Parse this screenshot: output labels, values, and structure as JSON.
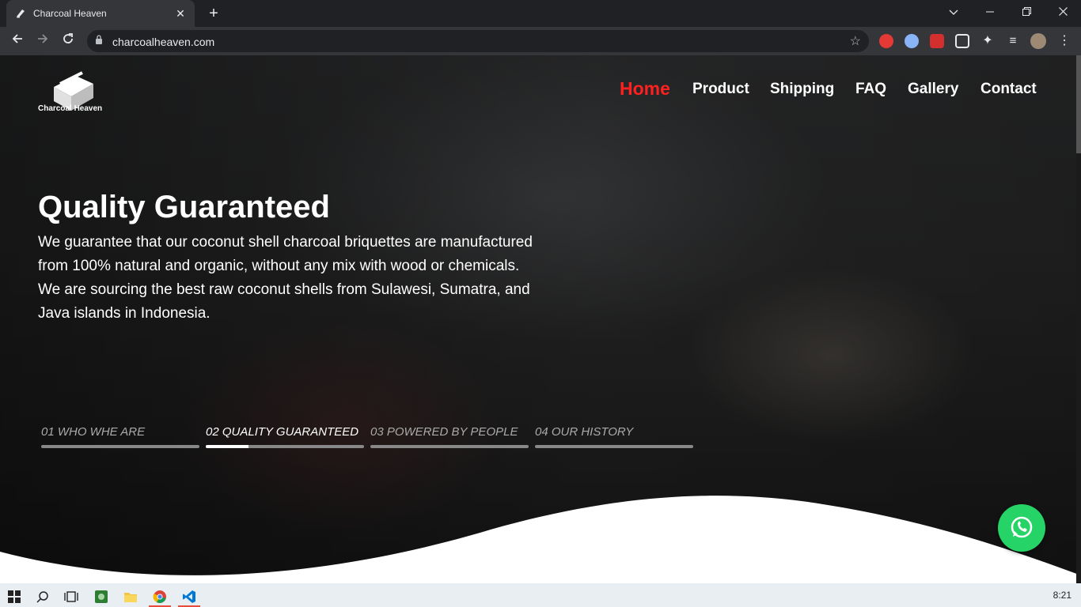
{
  "browser": {
    "tab_title": "Charcoal Heaven",
    "url": "charcoalheaven.com"
  },
  "site": {
    "logo_text": "Charcoal Heaven",
    "nav": [
      "Home",
      "Product",
      "Shipping",
      "FAQ",
      "Gallery",
      "Contact"
    ],
    "active_nav": "Home",
    "hero": {
      "title": "Quality Guaranteed",
      "description": "We guarantee that our coconut shell charcoal briquettes are manufactured from 100% natural and organic, without any mix with wood or chemicals. We are sourcing the best raw coconut shells from Sulawesi, Sumatra, and Java islands in Indonesia."
    },
    "steps": [
      {
        "label": "01 WHO WHE ARE",
        "progress": 0
      },
      {
        "label": "02 QUALITY GUARANTEED",
        "progress": 0.27
      },
      {
        "label": "03 POWERED BY PEOPLE",
        "progress": 0
      },
      {
        "label": "04 OUR HISTORY",
        "progress": 0
      }
    ],
    "active_step": 1,
    "whatsapp_icon": "whatsapp-icon"
  },
  "taskbar": {
    "clock": "8:21"
  },
  "colors": {
    "active_nav": "#ff2020",
    "whatsapp": "#25d366"
  }
}
